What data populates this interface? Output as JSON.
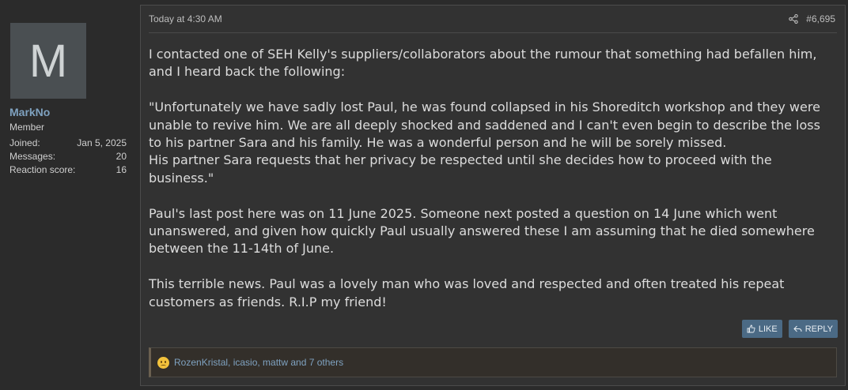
{
  "user": {
    "avatar_letter": "M",
    "name": "MarkNo",
    "title": "Member",
    "stats": [
      {
        "label": "Joined:",
        "value": "Jan 5, 2025"
      },
      {
        "label": "Messages:",
        "value": "20"
      },
      {
        "label": "Reaction score:",
        "value": "16"
      }
    ]
  },
  "post": {
    "date": "Today at 4:30 AM",
    "number": "#6,695",
    "paragraphs": [
      "I contacted one of SEH Kelly's suppliers/collaborators about the rumour that something had befallen him, and I heard back the following:",
      "\"Unfortunately we have sadly lost Paul, he was found collapsed in his Shoreditch workshop and they were unable to revive him. We are all deeply shocked and saddened and I can't even begin to describe the loss to his partner Sara and his family. He was a wonderful person and he will be sorely missed.\nHis partner Sara requests that her privacy be respected until she decides how to proceed with the business.\"",
      "Paul's last post here was on 11 June 2025. Someone next posted a question on 14 June which went unanswered, and given how quickly Paul usually answered these I am assuming that he died somewhere between the 11-14th of June.",
      "This terrible news. Paul was a lovely man who was loved and respected and often treated his repeat customers as friends. R.I.P my friend!"
    ]
  },
  "actions": {
    "like_label": "LIKE",
    "reply_label": "REPLY"
  },
  "reactions": {
    "text": "RozenKristal, icasio, mattw and 7 others"
  },
  "colors": {
    "accent": "#7fa2c0",
    "button": "#4b6a85"
  }
}
